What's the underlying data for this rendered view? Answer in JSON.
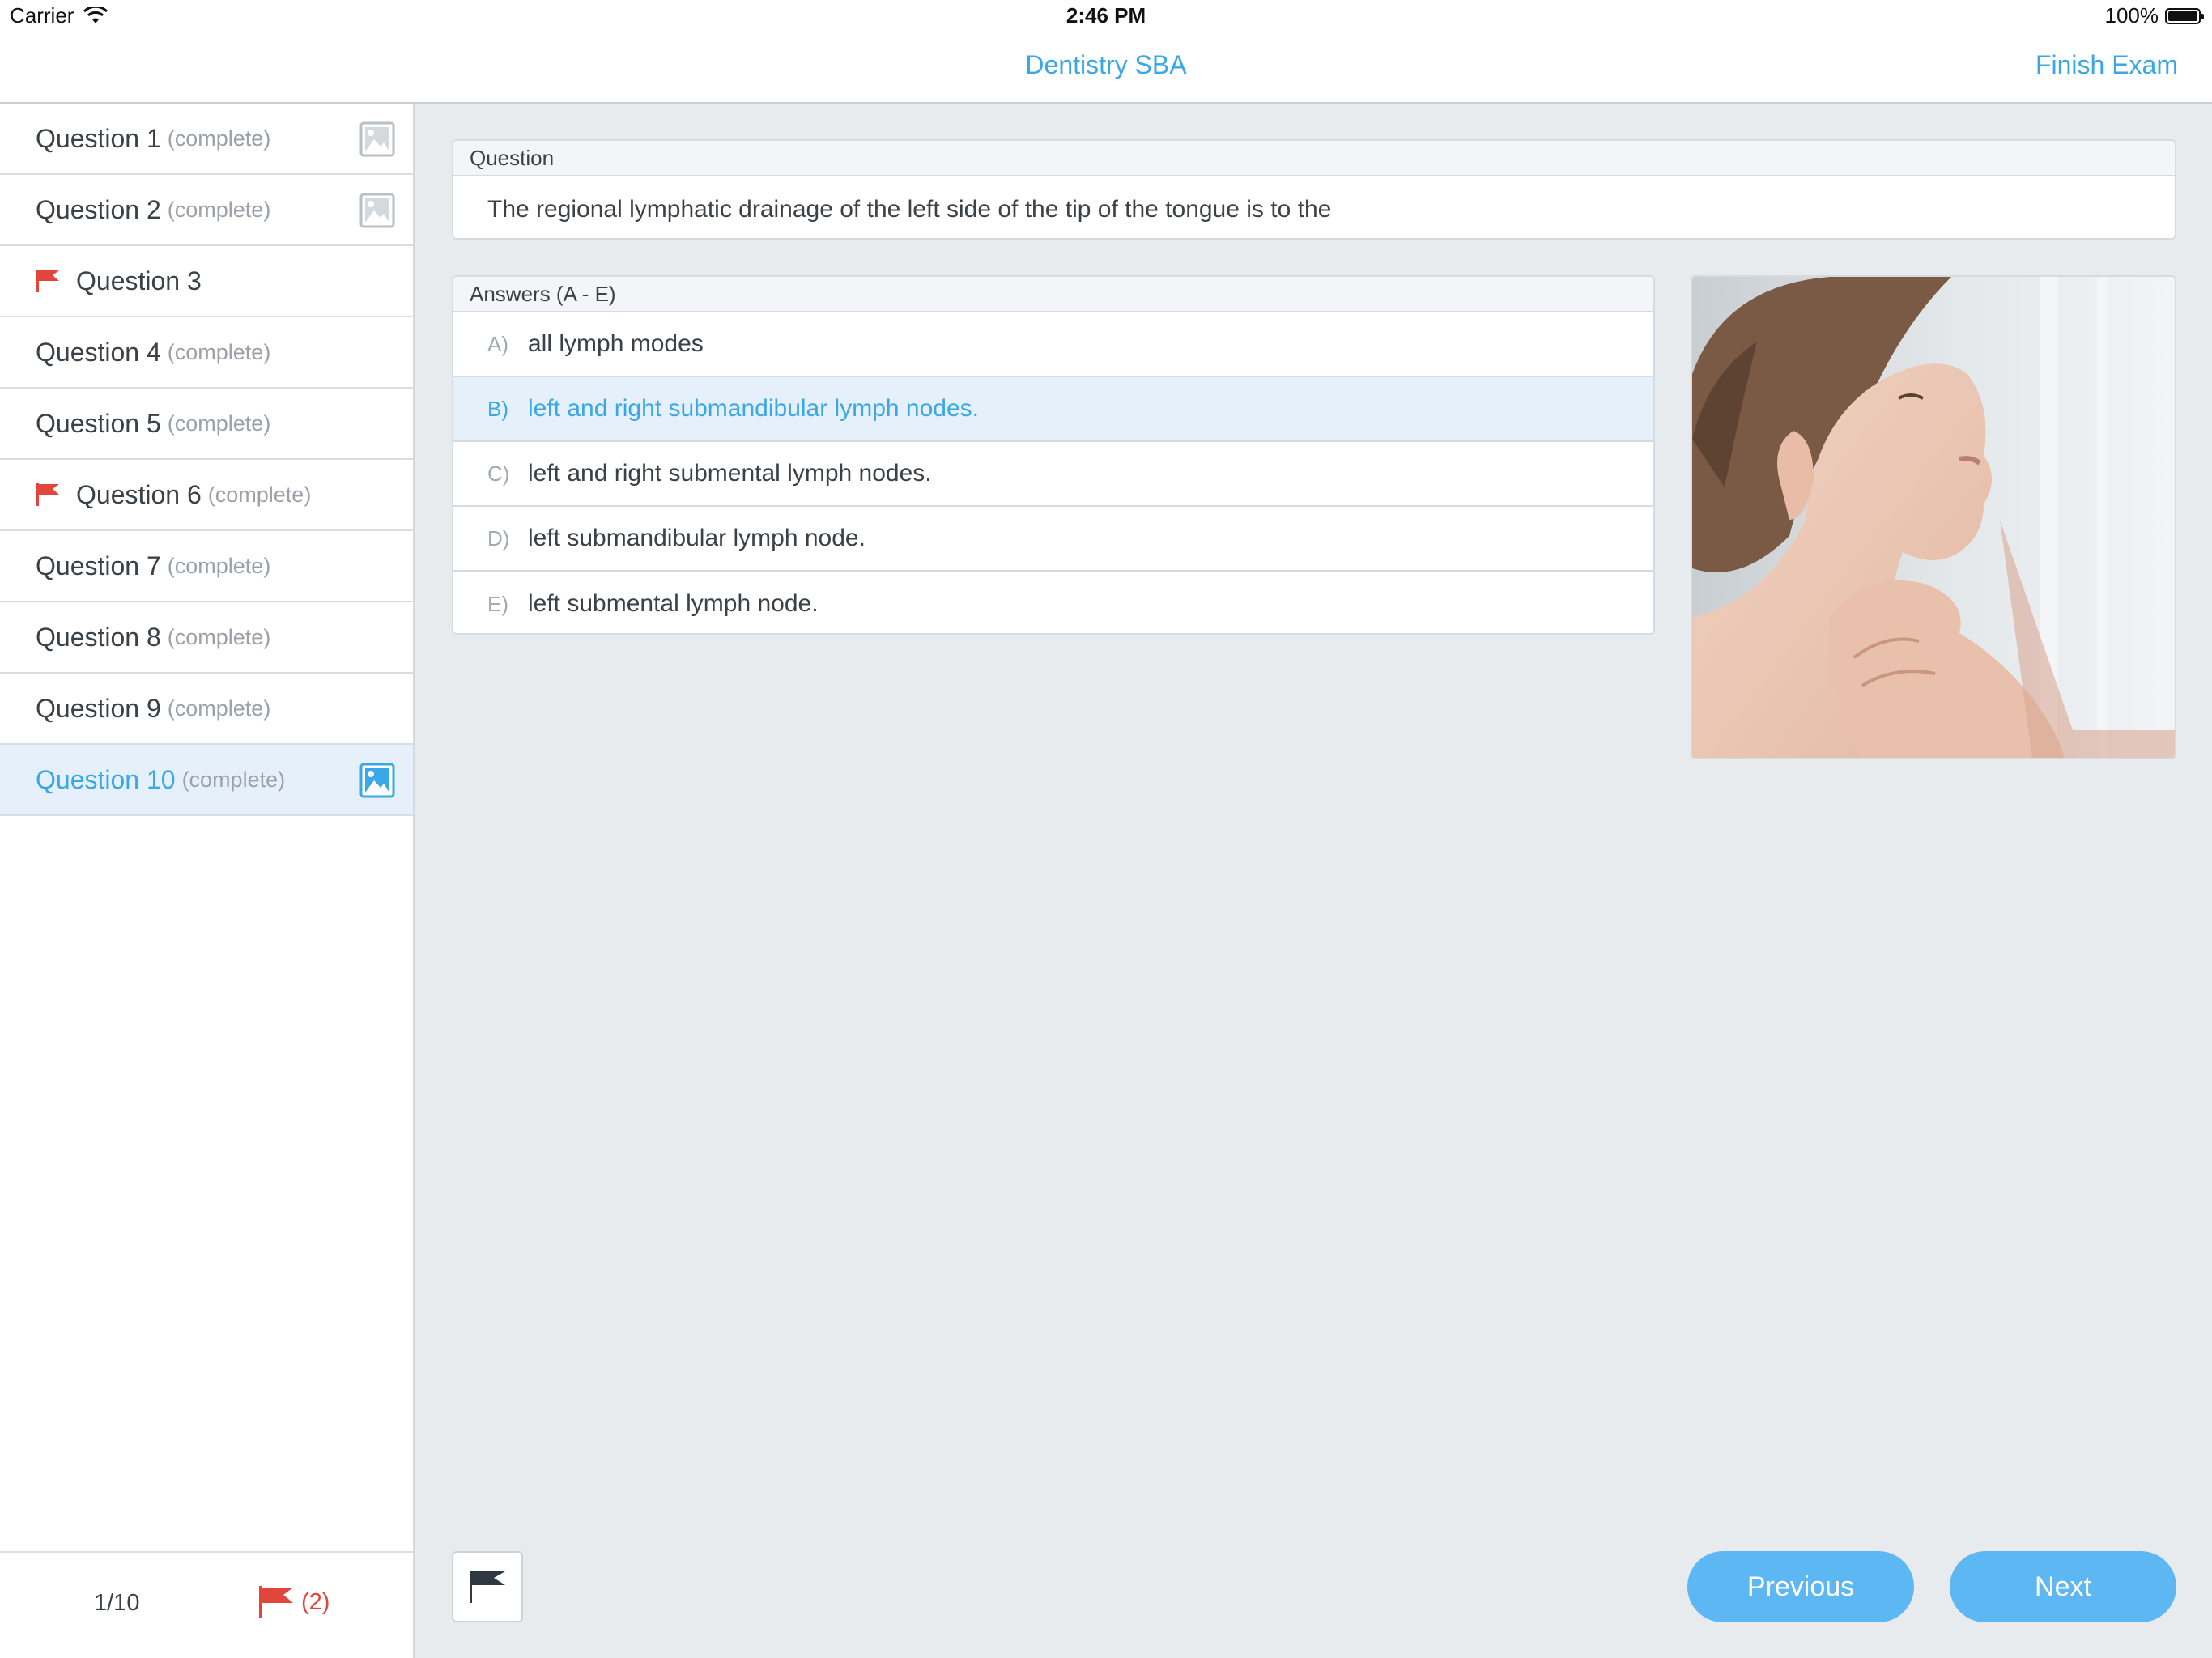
{
  "status_bar": {
    "carrier": "Carrier",
    "time": "2:46 PM",
    "battery": "100%"
  },
  "nav": {
    "title": "Dentistry SBA",
    "finish": "Finish Exam"
  },
  "sidebar": {
    "items": [
      {
        "label": "Question 1",
        "status": "(complete)",
        "flagged": false,
        "image": true,
        "selected": false
      },
      {
        "label": "Question 2",
        "status": "(complete)",
        "flagged": false,
        "image": true,
        "selected": false
      },
      {
        "label": "Question 3",
        "status": "",
        "flagged": true,
        "image": false,
        "selected": false
      },
      {
        "label": "Question 4",
        "status": "(complete)",
        "flagged": false,
        "image": false,
        "selected": false
      },
      {
        "label": "Question 5",
        "status": "(complete)",
        "flagged": false,
        "image": false,
        "selected": false
      },
      {
        "label": "Question 6",
        "status": "(complete)",
        "flagged": true,
        "image": false,
        "selected": false
      },
      {
        "label": "Question 7",
        "status": "(complete)",
        "flagged": false,
        "image": false,
        "selected": false
      },
      {
        "label": "Question 8",
        "status": "(complete)",
        "flagged": false,
        "image": false,
        "selected": false
      },
      {
        "label": "Question 9",
        "status": "(complete)",
        "flagged": false,
        "image": false,
        "selected": false
      },
      {
        "label": "Question 10",
        "status": "(complete)",
        "flagged": false,
        "image": true,
        "selected": true
      }
    ],
    "footer": {
      "page": "1/10",
      "flags": "(2)"
    }
  },
  "question": {
    "header": "Question",
    "text": "The regional lymphatic drainage of the left side of the tip of the tongue is to the"
  },
  "answers": {
    "header": "Answers (A - E)",
    "options": [
      {
        "letter": "A)",
        "text": "all lymph modes"
      },
      {
        "letter": "B)",
        "text": "left and right submandibular lymph nodes."
      },
      {
        "letter": "C)",
        "text": "left and right submental lymph nodes."
      },
      {
        "letter": "D)",
        "text": "left submandibular lymph node."
      },
      {
        "letter": "E)",
        "text": "left submental lymph node."
      }
    ],
    "selected_index": 1
  },
  "buttons": {
    "previous": "Previous",
    "next": "Next"
  },
  "colors": {
    "accent": "#3aa7e6",
    "flag": "#e0463c",
    "button": "#5db7f3",
    "selected_bg": "#e6f0fa"
  }
}
